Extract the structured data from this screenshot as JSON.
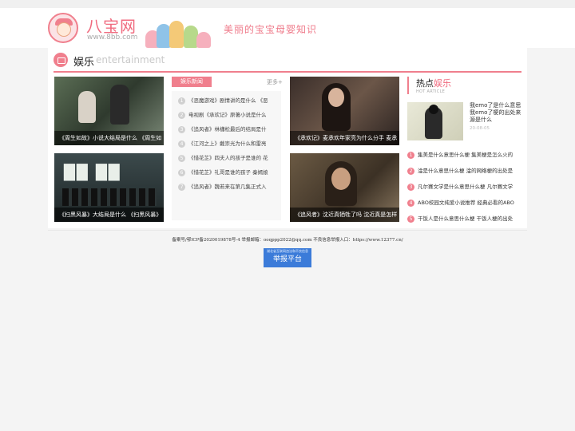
{
  "site": {
    "logo_title": "八宝网",
    "logo_url": "www.8bb.com",
    "slogan": "美丽的宝宝母婴知识"
  },
  "section": {
    "title": "娱乐",
    "subtitle": "entertainment"
  },
  "cards": [
    {
      "caption": "《周生如故》小说大结局是什么 《周生如"
    },
    {
      "caption": "《承欢记》麦承欢年家亮为什么分手 麦承"
    },
    {
      "caption": "《扫黑风暴》大结局是什么 《扫黑风暴》"
    },
    {
      "caption": "《追风者》沈近真牺牲了吗 沈近真是怎样"
    }
  ],
  "news": {
    "tag": "娱乐新闻",
    "more": "更多+",
    "items": [
      {
        "num": "1",
        "text": "《恶魔游戏》剧情讲的是什么 《恶"
      },
      {
        "num": "2",
        "text": "电视剧《承欢记》原著小说是什么"
      },
      {
        "num": "3",
        "text": "《追风者》林櫹松最后的结局是什"
      },
      {
        "num": "4",
        "text": "《江河之上》戴崇光为什么和雷亮"
      },
      {
        "num": "5",
        "text": "《惜花芷》四夫人的孩子是谁的 花"
      },
      {
        "num": "6",
        "text": "《惜花芷》礼哥是谁的孩子 秦嫣娘"
      },
      {
        "num": "7",
        "text": "《追风者》魏若来在第几集正式入"
      }
    ]
  },
  "hot": {
    "title_prefix": "热点",
    "title_accent": "娱乐",
    "subtitle": "HOT ARTICLE",
    "featured_title": "我emo了是什么意思 我emo了梗的出处来源是什么",
    "featured_date": "20-08-05",
    "items": [
      {
        "num": "1",
        "text": "集美是什么意思什么梗 集美梗是怎么火的"
      },
      {
        "num": "2",
        "text": "淦是什么意思什么梗 淦的网络梗的出处是"
      },
      {
        "num": "3",
        "text": "凡尔赛文学是什么意思什么梗 凡尔赛文学"
      },
      {
        "num": "4",
        "text": "ABO校园文纯爱小说推荐 经典必看的ABO"
      },
      {
        "num": "5",
        "text": "干饭人是什么意思什么梗 干饭人梗的出处"
      }
    ]
  },
  "footer": {
    "text": "备案号/鄂ICP备2020019878号-4 举报邮箱：ooqppp2022@qq.com 不良信息举报入口：https://www.12377.cn/",
    "report_small": "湖北省互联网违法和不良信息",
    "report_big": "举报平台"
  }
}
